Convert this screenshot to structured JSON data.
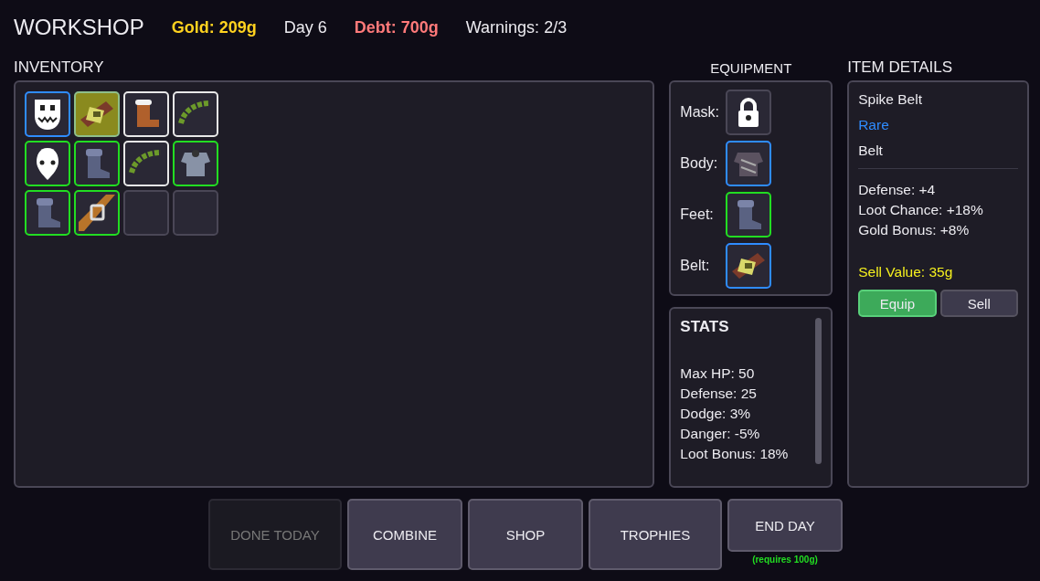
{
  "header": {
    "title": "WORKSHOP",
    "gold": "Gold: 209g",
    "day": "Day 6",
    "debt": "Debt: 700g",
    "warnings": "Warnings: 2/3"
  },
  "inventory": {
    "title": "INVENTORY",
    "slots": [
      {
        "kind": "grin-mask",
        "color": "#2f8cff",
        "selected": false
      },
      {
        "kind": "spike-belt",
        "color": "#8fbf8a",
        "selected": true
      },
      {
        "kind": "fur-boot",
        "color": "#e8e8e8",
        "selected": false
      },
      {
        "kind": "wreath",
        "color": "#e8e8e8",
        "selected": false
      },
      {
        "kind": "plain-mask",
        "color": "#22dd22",
        "selected": false
      },
      {
        "kind": "boot",
        "color": "#22dd22",
        "selected": false
      },
      {
        "kind": "wreath",
        "color": "#e8e8e8",
        "selected": false
      },
      {
        "kind": "armor",
        "color": "#22dd22",
        "selected": false
      },
      {
        "kind": "boot",
        "color": "#22dd22",
        "selected": false
      },
      {
        "kind": "leather-belt",
        "color": "#22dd22",
        "selected": false
      },
      {
        "kind": "empty",
        "selected": false
      },
      {
        "kind": "empty",
        "selected": false
      }
    ]
  },
  "equipment": {
    "title": "EQUIPMENT",
    "slots": [
      {
        "label": "Mask:",
        "kind": "locked"
      },
      {
        "label": "Body:",
        "kind": "dark-armor",
        "color": "#2f8cff"
      },
      {
        "label": "Feet:",
        "kind": "boot",
        "color": "#22dd22"
      },
      {
        "label": "Belt:",
        "kind": "spike-belt",
        "color": "#2f8cff"
      }
    ]
  },
  "stats": {
    "title": "STATS",
    "lines": [
      "Max HP: 50",
      "Defense: 25",
      "Dodge: 3%",
      "Danger: -5%",
      "Loot Bonus: 18%"
    ]
  },
  "details": {
    "title": "ITEM DETAILS",
    "name": "Spike Belt",
    "rarity": {
      "label": "Rare",
      "color": "#2f8cff"
    },
    "type": "Belt",
    "lines": [
      "Defense: +4",
      "Loot Chance: +18%",
      "Gold Bonus: +8%"
    ],
    "sell_value": "Sell Value: 35g",
    "buttons": [
      {
        "label": "Equip",
        "kind": "primary"
      },
      {
        "label": "Sell",
        "kind": "secondary"
      }
    ]
  },
  "actions": [
    {
      "label": "DONE TODAY",
      "disabled": true
    },
    {
      "label": "COMBINE",
      "disabled": false
    },
    {
      "label": "SHOP",
      "disabled": false
    },
    {
      "label": "TROPHIES",
      "disabled": false
    },
    {
      "label": "END DAY",
      "disabled": false,
      "note": "(requires 100g)"
    }
  ]
}
